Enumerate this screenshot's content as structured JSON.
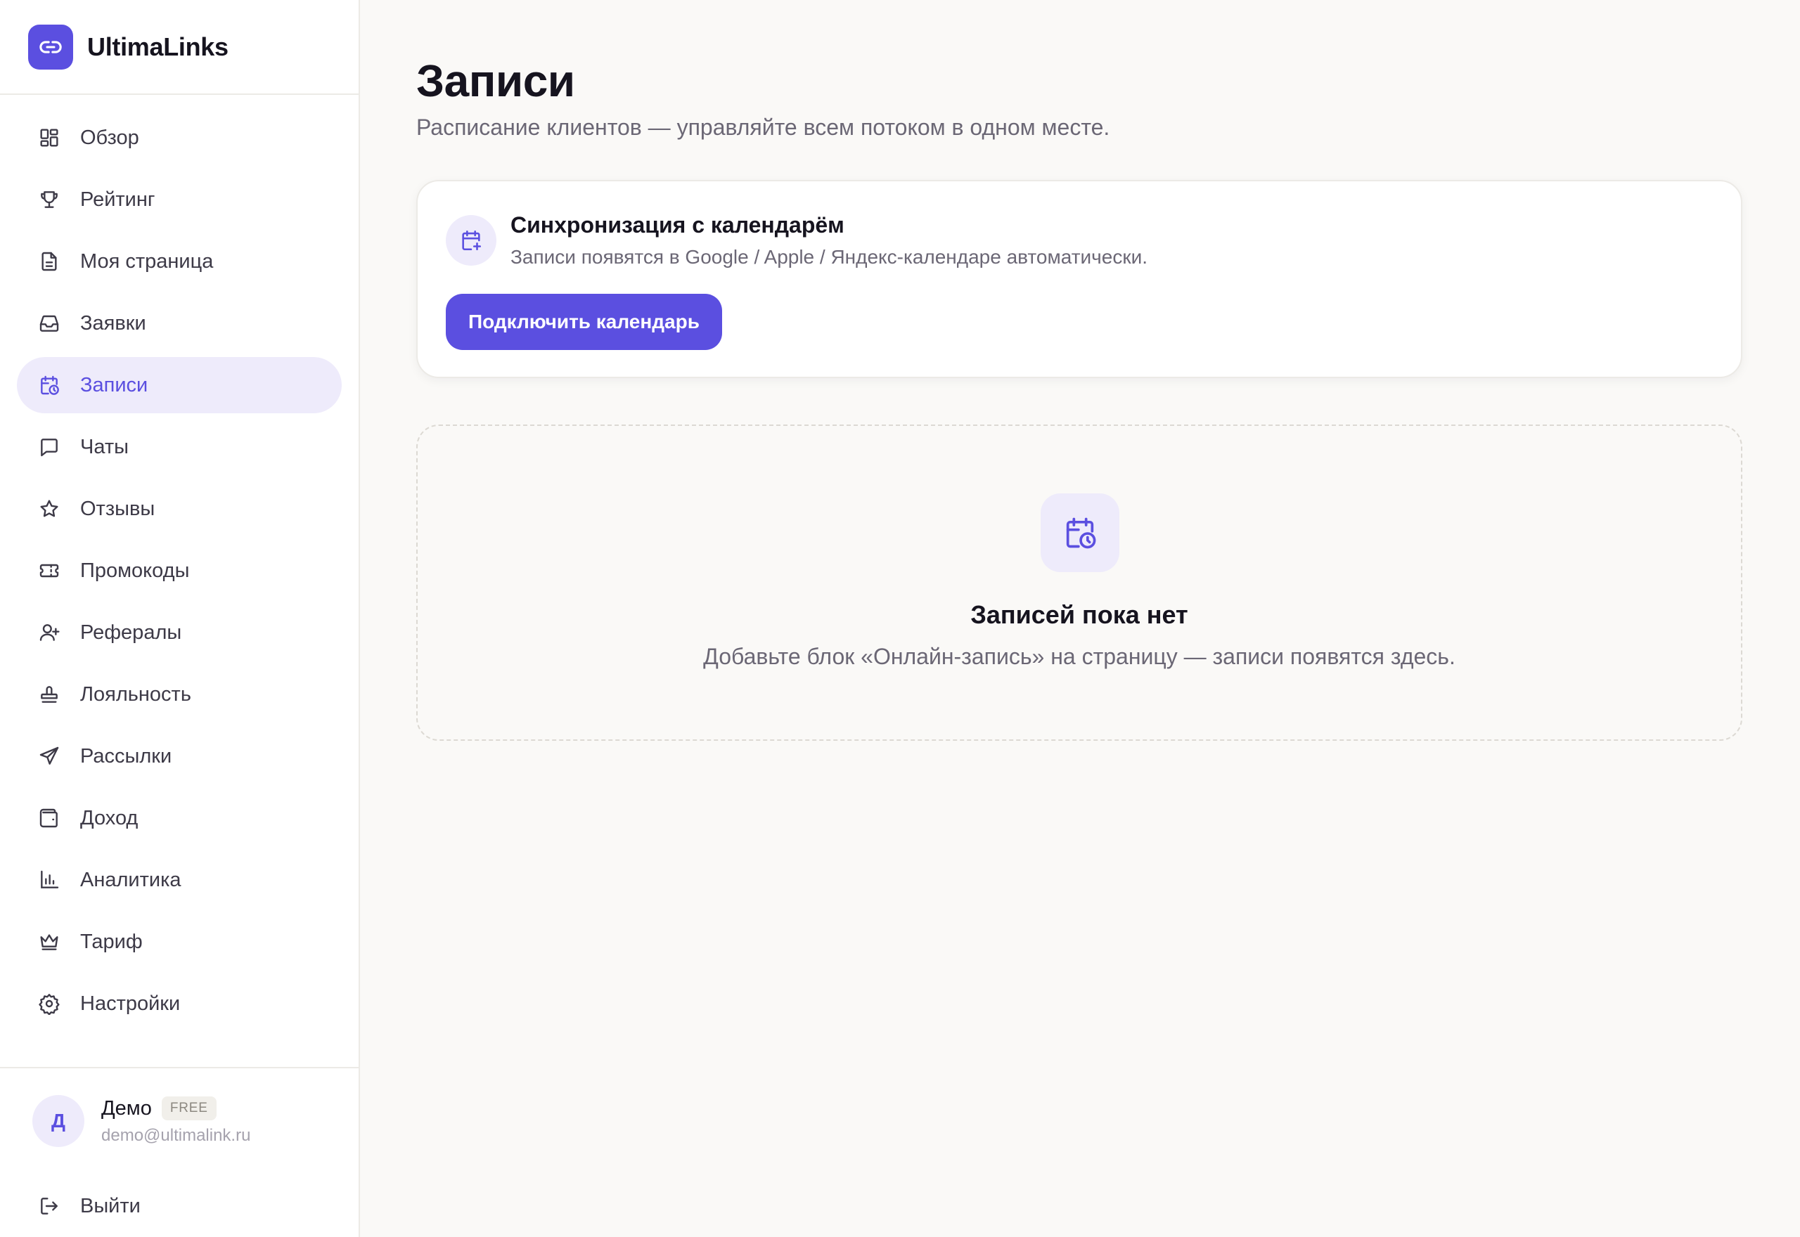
{
  "app": {
    "name": "UltimaLinks",
    "logo_icon": "link-icon",
    "accent_color": "#5b4fe0"
  },
  "sidebar": {
    "items": [
      {
        "label": "Обзор",
        "icon": "dashboard-grid-icon",
        "active": false
      },
      {
        "label": "Рейтинг",
        "icon": "trophy-icon",
        "active": false
      },
      {
        "label": "Моя страница",
        "icon": "document-icon",
        "active": false
      },
      {
        "label": "Заявки",
        "icon": "inbox-icon",
        "active": false
      },
      {
        "label": "Записи",
        "icon": "calendar-clock-icon",
        "active": true
      },
      {
        "label": "Чаты",
        "icon": "chat-bubble-icon",
        "active": false
      },
      {
        "label": "Отзывы",
        "icon": "star-icon",
        "active": false
      },
      {
        "label": "Промокоды",
        "icon": "ticket-icon",
        "active": false
      },
      {
        "label": "Рефералы",
        "icon": "user-plus-icon",
        "active": false
      },
      {
        "label": "Лояльность",
        "icon": "stamp-icon",
        "active": false
      },
      {
        "label": "Рассылки",
        "icon": "send-icon",
        "active": false
      },
      {
        "label": "Доход",
        "icon": "wallet-icon",
        "active": false
      },
      {
        "label": "Аналитика",
        "icon": "bar-chart-icon",
        "active": false
      },
      {
        "label": "Тариф",
        "icon": "crown-icon",
        "active": false
      },
      {
        "label": "Настройки",
        "icon": "gear-icon",
        "active": false
      }
    ]
  },
  "user": {
    "initial": "Д",
    "name": "Демо",
    "plan": "FREE",
    "email": "demo@ultimalink.ru"
  },
  "logout": {
    "label": "Выйти",
    "icon": "logout-icon"
  },
  "page": {
    "title": "Записи",
    "subtitle": "Расписание клиентов — управляйте всем потоком в одном месте."
  },
  "sync_card": {
    "icon": "calendar-plus-icon",
    "title": "Синхронизация с календарём",
    "description": "Записи появятся в Google / Apple / Яндекс-календаре автоматически.",
    "button_label": "Подключить календарь"
  },
  "empty_state": {
    "icon": "calendar-clock-icon",
    "title": "Записей пока нет",
    "description": "Добавьте блок «Онлайн-запись» на страницу — записи появятся здесь."
  }
}
